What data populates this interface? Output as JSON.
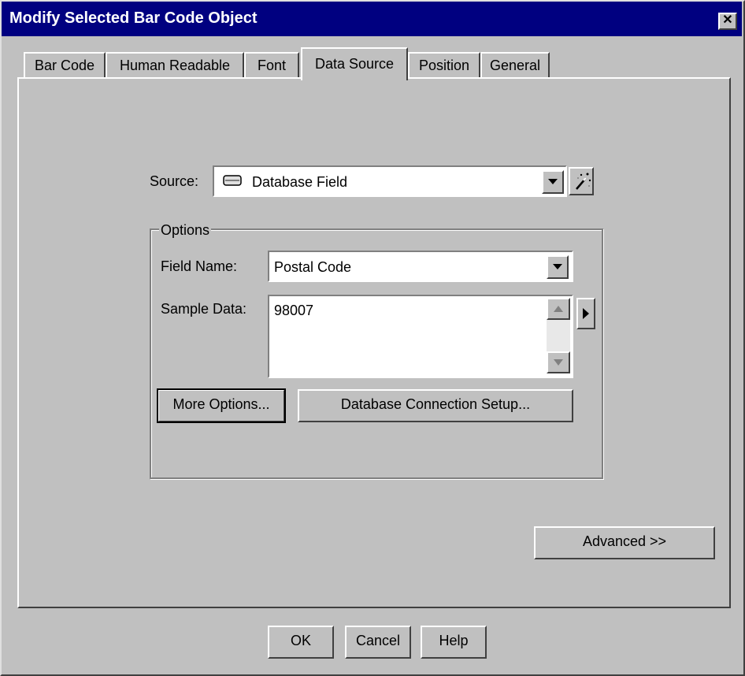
{
  "window": {
    "title": "Modify Selected Bar Code Object",
    "close_glyph": "✕"
  },
  "tabs": [
    {
      "label": "Bar Code",
      "active": false
    },
    {
      "label": "Human Readable",
      "active": false
    },
    {
      "label": "Font",
      "active": false
    },
    {
      "label": "Data Source",
      "active": true
    },
    {
      "label": "Position",
      "active": false
    },
    {
      "label": "General",
      "active": false
    }
  ],
  "source": {
    "label": "Source:",
    "value": "Database Field",
    "icon": "database-field-icon",
    "wizard_icon": "magic-wand-icon"
  },
  "options": {
    "group_label": "Options",
    "field_name_label": "Field Name:",
    "field_name_value": "Postal Code",
    "sample_data_label": "Sample Data:",
    "sample_data_value": "98007",
    "more_options_button": "More Options...",
    "db_connection_button": "Database Connection Setup..."
  },
  "advanced_button": "Advanced >>",
  "footer": {
    "ok": "OK",
    "cancel": "Cancel",
    "help": "Help"
  },
  "colors": {
    "titlebar": "#000080",
    "face": "#c0c0c0"
  }
}
